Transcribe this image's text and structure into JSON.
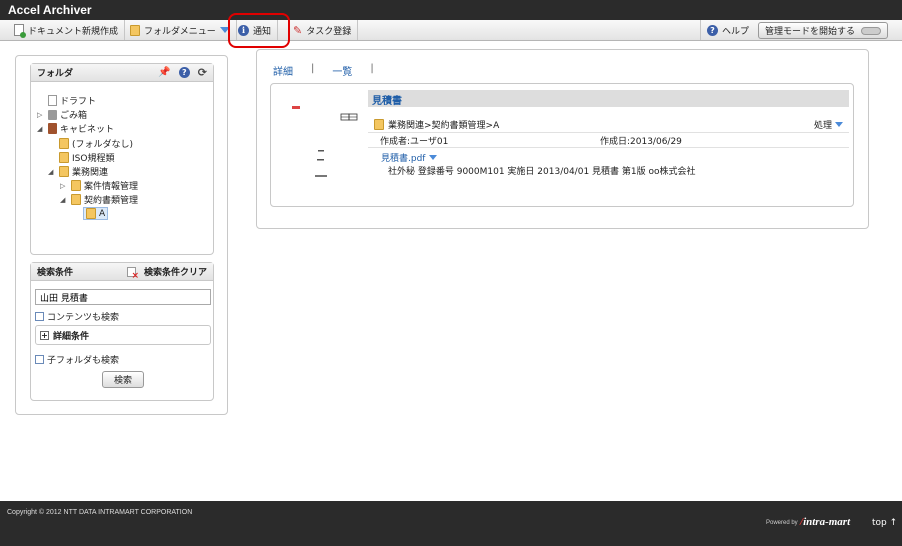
{
  "app_title": "Accel Archiver",
  "toolbar": {
    "new_document": "ドキュメント新規作成",
    "folder_menu": "フォルダメニュー",
    "notification": "通知",
    "task_register": "タスク登録",
    "help": "ヘルプ",
    "admin_mode": "管理モードを開始する"
  },
  "folder_panel": {
    "title": "フォルダ",
    "tree": [
      {
        "label": "ドラフト",
        "icon": "draft-icon"
      },
      {
        "label": "ごみ箱",
        "icon": "trash-icon"
      },
      {
        "label": "キャビネット",
        "icon": "cabinet-icon"
      },
      {
        "label": "(フォルダなし)",
        "icon": "folder-icon"
      },
      {
        "label": "ISO規程類",
        "icon": "folder-icon"
      },
      {
        "label": "業務関連",
        "icon": "folder-icon"
      },
      {
        "label": "案件情報管理",
        "icon": "folder-icon"
      },
      {
        "label": "契約書類管理",
        "icon": "folder-icon"
      },
      {
        "label": "A",
        "icon": "folder-icon"
      }
    ]
  },
  "search_panel": {
    "title": "検索条件",
    "clear": "検索条件クリア",
    "query_value": "山田 見積書",
    "content_search": "コンテンツも検索",
    "detail_conditions": "詳細条件",
    "subfolder_search": "子フォルダも検索",
    "search_button": "検索"
  },
  "view_tabs": {
    "detail": "詳細",
    "sep1": "|",
    "list": "一覧",
    "sep2": "|"
  },
  "result": {
    "title": "見積書",
    "path": "業務関連>契約書類管理>A",
    "action": "処理",
    "creator": "作成者:ユーザ01",
    "created": "作成日:2013/06/29",
    "file_name": "見積書.pdf",
    "description": "社外秘 登録番号 9000M101 実施日 2013/04/01 見積書 第1版 oo株式会社"
  },
  "footer": {
    "copyright": "Copyright © 2012 NTT DATA INTRAMART CORPORATION",
    "powered_by": "Powered by",
    "brand": "intra-mart",
    "top": "top ↑"
  },
  "colors": {
    "accent_blue": "#1f5ea8",
    "highlight_red": "#e00000",
    "folder": "#f4c660"
  }
}
